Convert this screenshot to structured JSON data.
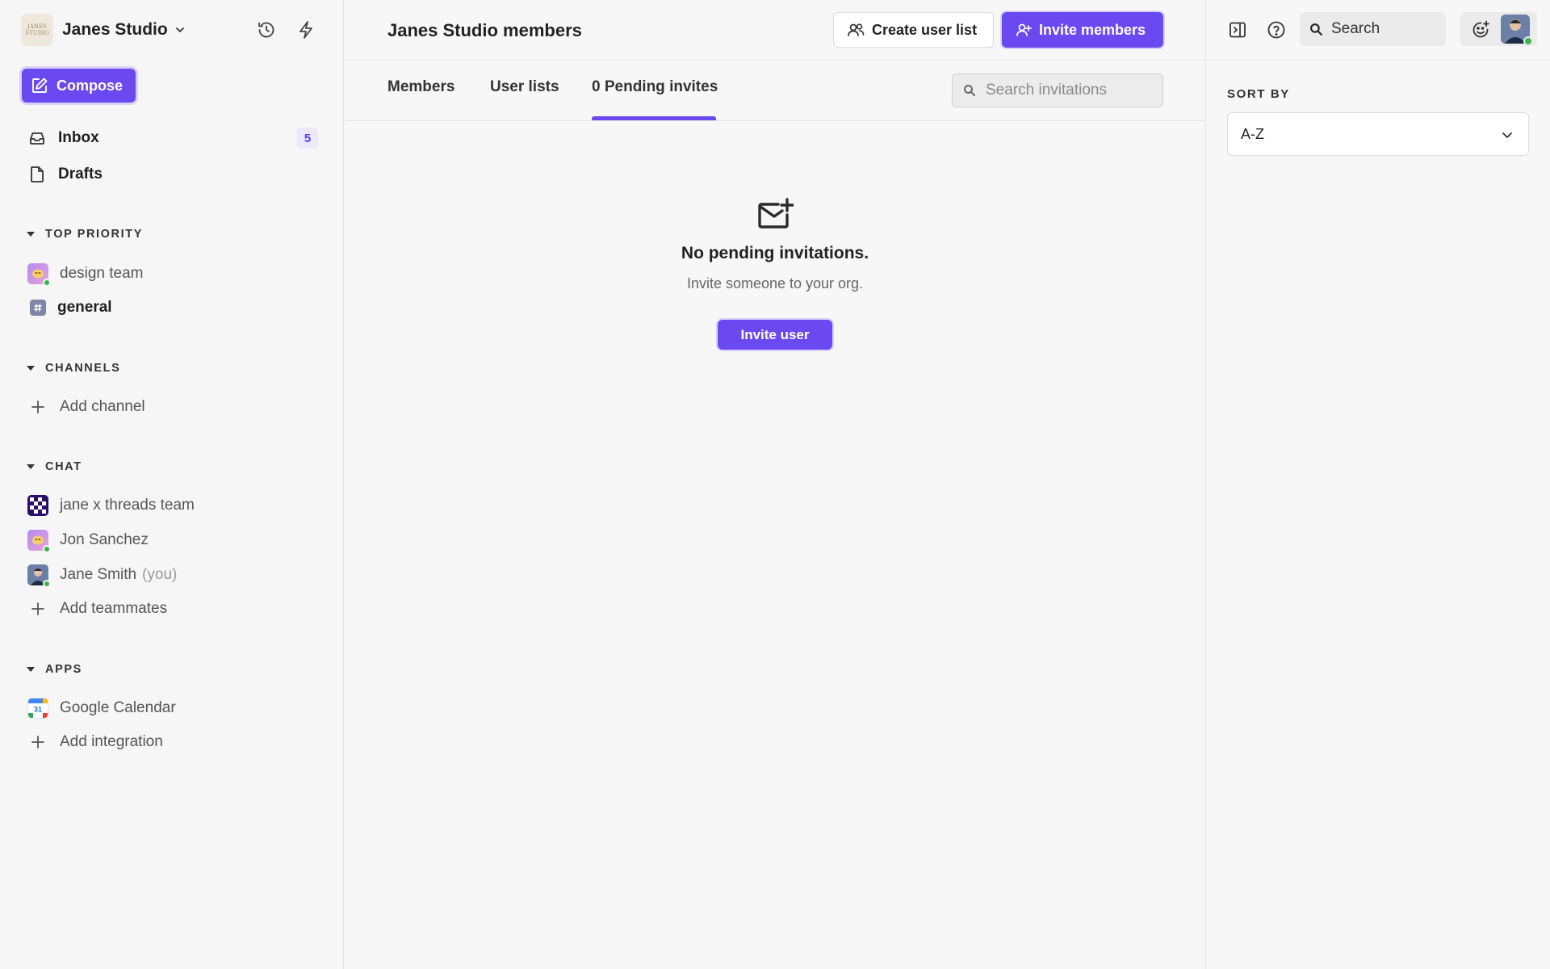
{
  "workspace": {
    "name": "Janes Studio",
    "logo_text": "JANES STUDIO"
  },
  "compose_label": "Compose",
  "nav": {
    "inbox": {
      "label": "Inbox",
      "badge": "5"
    },
    "drafts": {
      "label": "Drafts"
    }
  },
  "sections": {
    "top_priority": {
      "title": "TOP PRIORITY",
      "items": [
        "design team",
        "general"
      ]
    },
    "channels": {
      "title": "CHANNELS",
      "add_label": "Add channel"
    },
    "chat": {
      "title": "CHAT",
      "items": [
        "jane x threads team",
        "Jon Sanchez",
        "Jane Smith"
      ],
      "self_suffix": "(you)",
      "add_label": "Add teammates"
    },
    "apps": {
      "title": "APPS",
      "items": [
        "Google Calendar"
      ],
      "add_label": "Add integration",
      "calendar_day": "31"
    }
  },
  "main": {
    "title": "Janes Studio members",
    "create_list_label": "Create user list",
    "invite_members_label": "Invite members",
    "tabs": [
      "Members",
      "User lists",
      "0 Pending invites"
    ],
    "active_tab": "0 Pending invites",
    "search_placeholder": "Search invitations",
    "empty_title": "No pending invitations.",
    "empty_subtitle": "Invite someone to your org.",
    "invite_user_label": "Invite user"
  },
  "right_panel": {
    "search_label": "Search",
    "sort_by_label": "SORT BY",
    "sort_value": "A-Z"
  },
  "colors": {
    "accent": "#6b49f0",
    "online": "#3bb54a",
    "badge_bg": "#ece8fd"
  },
  "icons": [
    "chevron-down-icon",
    "history-icon",
    "lightning-icon",
    "compose-icon",
    "inbox-icon",
    "drafts-icon",
    "caret-down-icon",
    "plus-icon",
    "users-icon",
    "user-plus-icon",
    "search-icon",
    "mail-plus-icon",
    "sidebar-toggle-icon",
    "help-icon",
    "emoji-add-icon"
  ]
}
